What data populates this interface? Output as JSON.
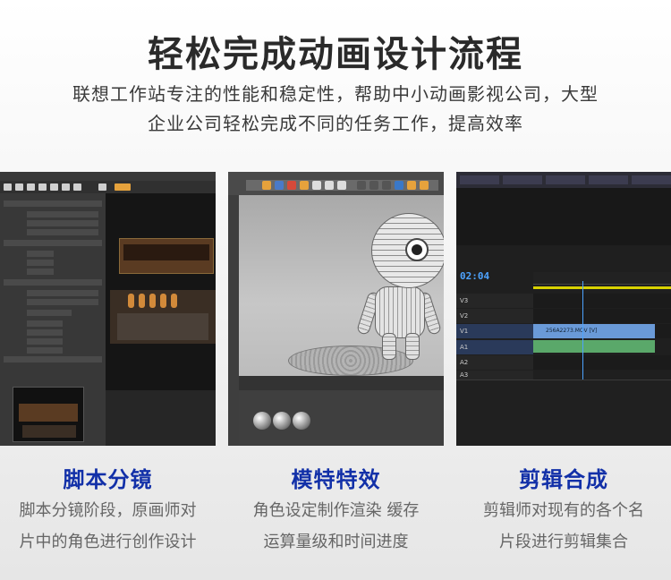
{
  "header": {
    "title": "轻松完成动画设计流程",
    "subtitle_line1": "联想工作站专注的性能和稳定性，帮助中小动画影视公司，大型",
    "subtitle_line2": "企业公司轻松完成不同的任务工作，提高效率"
  },
  "cards": [
    {
      "title": "脚本分镜",
      "desc_line1": "脚本分镜阶段，原画师对",
      "desc_line2": "片中的角色进行创作设计"
    },
    {
      "title": "模特特效",
      "desc_line1": "角色设定制作渲染 缓存",
      "desc_line2": "运算量级和时间进度"
    },
    {
      "title": "剪辑合成",
      "desc_line1": "剪辑师对现有的各个名",
      "desc_line2": "片段进行剪辑集合"
    }
  ],
  "screen3": {
    "timecode": "02:04",
    "clip_label": "256A2273.MOV [V]",
    "tracks": [
      "V3",
      "V2",
      "V1",
      "A1",
      "A2",
      "A3"
    ]
  },
  "colors": {
    "card_title": "#1230a8",
    "accent_blue": "#4da3ff",
    "timeline_yellow": "#d9d200"
  }
}
